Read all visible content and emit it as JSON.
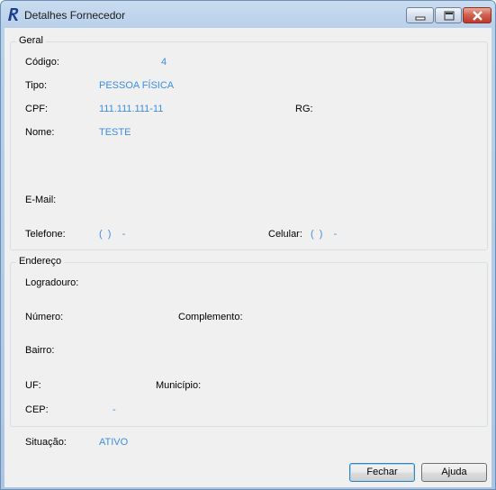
{
  "window": {
    "title": "Detalhes Fornecedor"
  },
  "geral": {
    "legend": "Geral",
    "codigo_label": "Código:",
    "codigo_value": "4",
    "tipo_label": "Tipo:",
    "tipo_value": "PESSOA FÍSICA",
    "cpf_label": "CPF:",
    "cpf_value": "111.111.111-11",
    "rg_label": "RG:",
    "nome_label": "Nome:",
    "nome_value": "TESTE",
    "email_label": "E-Mail:",
    "telefone_label": "Telefone:",
    "telefone_value": "(  )    -",
    "celular_label": "Celular:",
    "celular_value": "(  )    -"
  },
  "endereco": {
    "legend": "Endereço",
    "logradouro_label": "Logradouro:",
    "numero_label": "Número:",
    "complemento_label": "Complemento:",
    "bairro_label": "Bairro:",
    "uf_label": "UF:",
    "municipio_label": "Município:",
    "cep_label": "CEP:",
    "cep_value": "-"
  },
  "situacao": {
    "label": "Situação:",
    "value": "ATIVO"
  },
  "buttons": {
    "fechar": "Fechar",
    "ajuda": "Ajuda"
  },
  "icons": {
    "app": "app-logo-icon",
    "minimize": "minimize-icon",
    "maximize": "maximize-icon",
    "close": "close-icon"
  },
  "colors": {
    "value_text": "#3b8ee0",
    "close_button": "#c0392b"
  }
}
